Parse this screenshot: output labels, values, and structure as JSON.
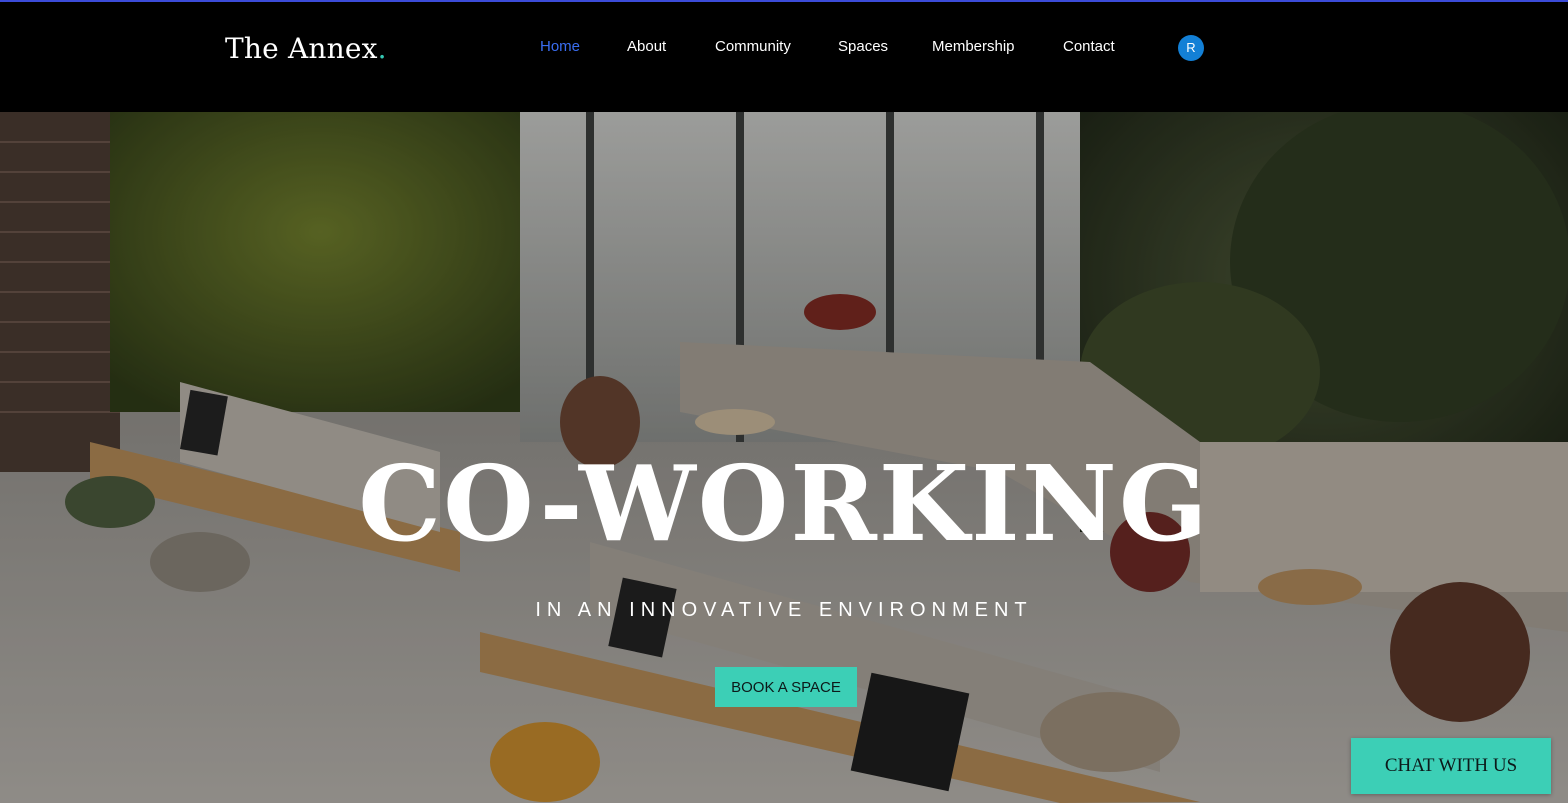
{
  "brand": {
    "name": "The Annex",
    "dot": ".",
    "dot_color": "#35c9b4"
  },
  "nav": {
    "items": [
      {
        "label": "Home",
        "active": true
      },
      {
        "label": "About"
      },
      {
        "label": "Community"
      },
      {
        "label": "Spaces"
      },
      {
        "label": "Membership"
      },
      {
        "label": "Contact"
      }
    ],
    "active_color": "#3a6df0"
  },
  "account": {
    "avatar_initial": "R",
    "avatar_color": "#1380d6"
  },
  "hero": {
    "title": "CO-WORKING",
    "subtitle": "IN AN INNOVATIVE ENVIRONMENT",
    "cta_label": "BOOK A SPACE",
    "background": "coworking-office-photo"
  },
  "chat": {
    "label": "CHAT WITH US"
  },
  "colors": {
    "accent": "#3ccfb6",
    "header_bg": "#000000"
  }
}
